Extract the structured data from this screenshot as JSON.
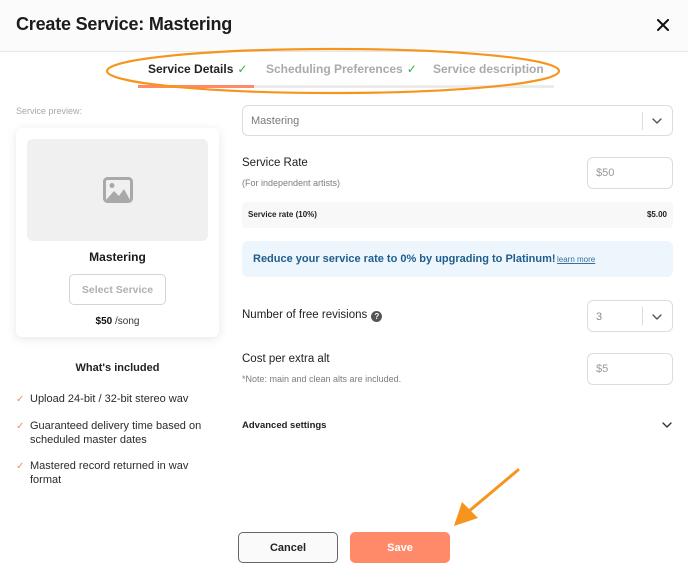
{
  "header": {
    "title": "Create Service: Mastering",
    "close_icon": "close-icon"
  },
  "tabs": [
    {
      "label": "Service Details",
      "completed": true,
      "active": true
    },
    {
      "label": "Scheduling Preferences",
      "completed": true,
      "active": false
    },
    {
      "label": "Service description",
      "completed": false,
      "active": false
    }
  ],
  "tab_check_glyph": "✓",
  "tab_progress_fraction": 0.28,
  "preview": {
    "label": "Service preview:",
    "image_icon": "image-placeholder-icon",
    "name": "Mastering",
    "select_button": "Select Service",
    "price": "$50",
    "price_unit": " /song"
  },
  "included": {
    "title": "What's included",
    "check_glyph": "✓",
    "items": [
      "Upload 24-bit / 32-bit stereo wav",
      "Guaranteed delivery time based on scheduled master dates",
      "Mastered record returned in wav format"
    ]
  },
  "form": {
    "service_type": {
      "value": "Mastering"
    },
    "service_rate": {
      "label": "Service Rate",
      "sublabel": "(For independent artists)",
      "placeholder": "$50"
    },
    "fee_row": {
      "label": "Service rate (10%)",
      "value": "$5.00"
    },
    "promo": {
      "message": "Reduce your service rate to 0% by upgrading to Platinum!",
      "link": "learn more"
    },
    "free_revisions": {
      "label": "Number of free revisions",
      "value": "3",
      "help_glyph": "?"
    },
    "extra_alt": {
      "label": "Cost per extra alt",
      "note": "*Note: main and clean alts are included.",
      "placeholder": "$5"
    },
    "advanced": {
      "label": "Advanced settings"
    }
  },
  "footer": {
    "cancel": "Cancel",
    "save": "Save"
  },
  "colors": {
    "accent": "#ff8a69",
    "check_green": "#2fae4e",
    "promo_text": "#1f5d8c",
    "annotation": "#f7941d"
  }
}
